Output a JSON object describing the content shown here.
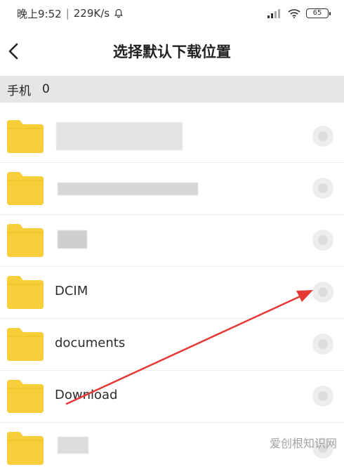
{
  "status_bar": {
    "time": "晚上9:52",
    "separator": "|",
    "network_speed": "229K/s",
    "battery": "65"
  },
  "header": {
    "title": "选择默认下载位置"
  },
  "path_bar": {
    "root": "手机",
    "depth": "0"
  },
  "folders": [
    {
      "name": ""
    },
    {
      "name": ""
    },
    {
      "name": ""
    },
    {
      "name": "DCIM"
    },
    {
      "name": "documents"
    },
    {
      "name": "Download"
    },
    {
      "name": ""
    }
  ],
  "colors": {
    "folder": "#f7cf3a",
    "annotation_arrow": "#e53935",
    "path_bar_bg": "#e6e6e6"
  },
  "watermark": "爱创根知识网"
}
